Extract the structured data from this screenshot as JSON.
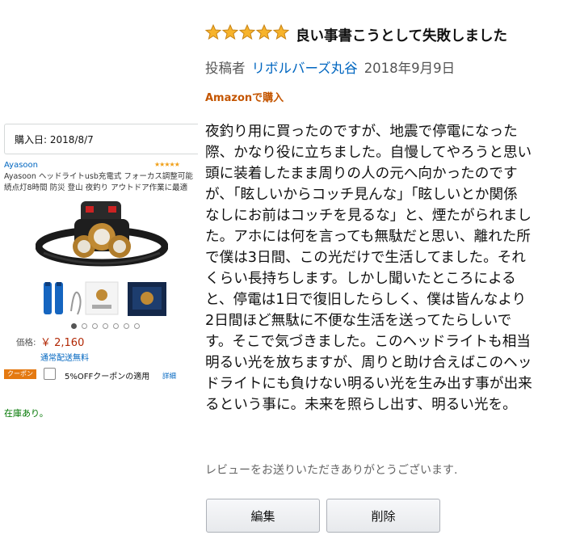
{
  "product": {
    "purchase_date": "購入日: 2018/8/7",
    "brand": "Ayasoon",
    "name_lines": [
      "Ayasoon ヘッドライトusb充電式 フォーカス調整可能",
      "続点灯8時間 防災 登山 夜釣り アウトドア作業に最適"
    ],
    "price_label": "価格:",
    "price": "￥ 2,160",
    "shipping": "通常配送無料",
    "coupon_badge": "クーポン",
    "coupon_text": "5%OFFクーポンの適用",
    "coupon_detail": "詳細",
    "stock": "在庫あり。",
    "image_dots": 7,
    "image_dots_active": 0,
    "rating_stars": 5
  },
  "review": {
    "rating": 5,
    "title": "良い事書こうとして失敗しました",
    "byline_prefix": "投稿者",
    "author": "リボルバーズ丸谷",
    "date": "2018年9月9日",
    "verified": "Amazonで購入",
    "body_lines": [
      "夜釣り用に買ったのですが、地震で停電になった",
      "際、かなり役に立ちました。自慢してやろうと思い",
      "頭に装着したまま周りの人の元へ向かったのです",
      "が、「眩しいからコッチ見んな」「眩しいとか関係",
      "なしにお前はコッチを見るな」と、煙たがられまし",
      "た。アホには何を言っても無駄だと思い、離れた所",
      "で僕は3日間、この光だけで生活してました。それ",
      "くらい長持ちします。しかし聞いたところによる",
      "と、停電は1日で復旧したらしく、僕は皆んなより",
      "2日間ほど無駄に不便な生活を送ってたらしいで",
      "す。そこで気づきました。このヘッドライトも相当",
      "明るい光を放ちますが、周りと助け合えばこのヘッ",
      "ドライトにも負けない明るい光を生み出す事が出来",
      "るという事に。未来を照らし出す、明るい光を。"
    ],
    "thanks": "レビューをお送りいただきありがとうございます.",
    "edit_label": "編集",
    "delete_label": "削除"
  },
  "colors": {
    "link": "#0066c0",
    "price": "#b12704",
    "star": "#f0a01a",
    "verified": "#c45500",
    "stock": "#007600"
  }
}
